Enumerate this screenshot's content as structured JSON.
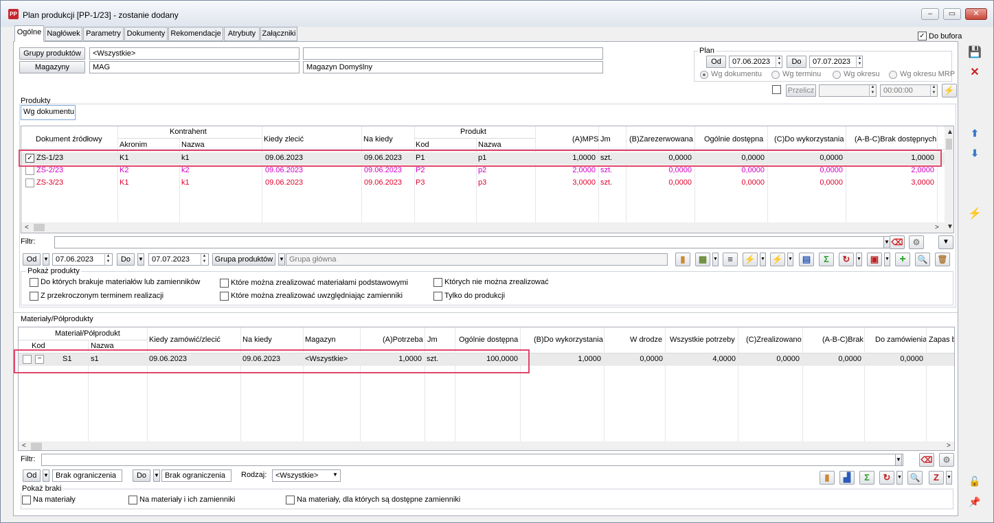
{
  "window": {
    "app_icon": "PP",
    "title": "Plan produkcji [PP-1/23] - zostanie dodany",
    "buttons": {
      "minimize": "–",
      "maximize": "▭",
      "close": "✕"
    }
  },
  "tabs": [
    {
      "label": "Ogólne",
      "active": true
    },
    {
      "label": "Nagłówek"
    },
    {
      "label": "Parametry"
    },
    {
      "label": "Dokumenty"
    },
    {
      "label": "Rekomendacje"
    },
    {
      "label": "Atrybuty"
    },
    {
      "label": "Załączniki"
    }
  ],
  "do_bufora": {
    "label": "Do bufora",
    "checked": true,
    "check_mark": "✓"
  },
  "filters_top": {
    "grupy_produktow_label": "Grupy produktów",
    "grupy_produktow_value": "<Wszystkie>",
    "grupy_produktow_desc": "",
    "magazyny_label": "Magazyny",
    "magazyny_value": "MAG",
    "magazyny_desc": "Magazyn Domyślny"
  },
  "plan": {
    "title": "Plan",
    "od_label": "Od",
    "od_value": "07.06.2023",
    "do_label": "Do",
    "do_value": "07.07.2023",
    "radios": [
      {
        "label": "Wg dokumentu",
        "selected": true
      },
      {
        "label": "Wg terminu"
      },
      {
        "label": "Wg okresu"
      },
      {
        "label": "Wg okresu MRP"
      }
    ],
    "przelicz_label": "Przelicz",
    "przelicz_value": "",
    "time_value": "00:00:00"
  },
  "produkty": {
    "section_title": "Produkty",
    "subtab": "Wg dokumentu",
    "header_groups": {
      "kontrahent": "Kontrahent",
      "produkt": "Produkt"
    },
    "columns": {
      "dokument": "Dokument źródłowy",
      "akronim": "Akronim",
      "nazwa_k": "Nazwa",
      "kiedy_zlecic": "Kiedy zlecić",
      "na_kiedy": "Na kiedy",
      "kod": "Kod",
      "nazwa_p": "Nazwa",
      "mps": "(A)MPS",
      "jm": "Jm",
      "zarezerwowana": "(B)Zarezerwowana",
      "ogolnie": "Ogólnie dostępna",
      "do_wykorzystania": "(C)Do wykorzystania",
      "brak": "(A-B-C)Brak dostępnych"
    },
    "rows": [
      {
        "checked": true,
        "doc": "ZS-1/23",
        "akronim": "K1",
        "nazwa_k": "k1",
        "kiedy": "09.06.2023",
        "na_kiedy": "09.06.2023",
        "kod": "P1",
        "nazwa_p": "p1",
        "mps": "1,0000",
        "jm": "szt.",
        "zar": "0,0000",
        "ogol": "0,0000",
        "dowyk": "0,0000",
        "brak": "1,0000",
        "color": "#000000"
      },
      {
        "checked": false,
        "doc": "ZS-2/23",
        "akronim": "K2",
        "nazwa_k": "k2",
        "kiedy": "09.06.2023",
        "na_kiedy": "09.06.2023",
        "kod": "P2",
        "nazwa_p": "p2",
        "mps": "2,0000",
        "jm": "szt.",
        "zar": "0,0000",
        "ogol": "0,0000",
        "dowyk": "0,0000",
        "brak": "2,0000",
        "color": "#d000c8"
      },
      {
        "checked": false,
        "doc": "ZS-3/23",
        "akronim": "K1",
        "nazwa_k": "k1",
        "kiedy": "09.06.2023",
        "na_kiedy": "09.06.2023",
        "kod": "P3",
        "nazwa_p": "p3",
        "mps": "3,0000",
        "jm": "szt.",
        "zar": "0,0000",
        "ogol": "0,0000",
        "dowyk": "0,0000",
        "brak": "3,0000",
        "color": "#e0002a"
      }
    ],
    "filtr_label": "Filtr:",
    "filtr_value": "",
    "od_label": "Od",
    "od_value": "07.06.2023",
    "do_label": "Do",
    "do_value": "07.07.2023",
    "grupa_label": "Grupa produktów",
    "grupa_value": "Grupa główna",
    "pokaz_title": "Pokaż produkty",
    "pokaz_options": [
      "Do których brakuje materiałów lub zamienników",
      "Z przekroczonym terminem realizacji",
      "Które można zrealizować materiałami podstawowymi",
      "Które można zrealizować uwzględniając zamienniki",
      "Których nie można zrealizować",
      "Tylko do produkcji"
    ]
  },
  "materialy": {
    "section_title": "Materiały/Półprodukty",
    "header_group": "Materiał/Półprodukt",
    "columns": {
      "kod": "Kod",
      "nazwa": "Nazwa",
      "kiedy": "Kiedy zamówić/zlecić",
      "na_kiedy": "Na kiedy",
      "magazyn": "Magazyn",
      "potrzeba": "(A)Potrzeba",
      "jm": "Jm",
      "ogolnie": "Ogólnie dostępna",
      "dowyk": "(B)Do wykorzystania",
      "w_drodze": "W drodze",
      "wszystkie": "Wszystkie potrzeby",
      "zrealizowano": "(C)Zrealizowano",
      "brak": "(A-B-C)Brak",
      "do_zamowienia": "Do zamówienia",
      "zapas": "Zapas b"
    },
    "rows": [
      {
        "expand": "−",
        "kod": "S1",
        "nazwa": "s1",
        "kiedy": "09.06.2023",
        "na_kiedy": "09.06.2023",
        "magazyn": "<Wszystkie>",
        "potrzeba": "1,0000",
        "jm": "szt.",
        "ogol": "100,0000",
        "dowyk": "1,0000",
        "w_drodze": "0,0000",
        "wszystkie": "4,0000",
        "zreal": "0,0000",
        "brak": "0,0000",
        "do_zam": "0,0000"
      }
    ],
    "filtr_label": "Filtr:",
    "filtr_value": "",
    "od_label": "Od",
    "od_value": "Brak ograniczenia",
    "do_label": "Do",
    "do_value": "Brak ograniczenia",
    "rodzaj_label": "Rodzaj:",
    "rodzaj_value": "<Wszystkie>",
    "pokaz_title": "Pokaż braki",
    "pokaz_options": [
      "Na materiały",
      "Na materiały i ich zamienniki",
      "Na materiały, dla których są dostępne zamienniki"
    ]
  },
  "icons": {
    "save": "💾",
    "cancel": "✕",
    "lightning": "⚡",
    "sigma": "Σ",
    "plus": "+",
    "search": "🔍",
    "trash": "🗑",
    "lock": "🔓",
    "pin": "📌"
  },
  "colors": {
    "accent": "#e0456a",
    "row_selected": "#eaeaea",
    "magenta": "#d000c8",
    "red": "#e0002a"
  }
}
